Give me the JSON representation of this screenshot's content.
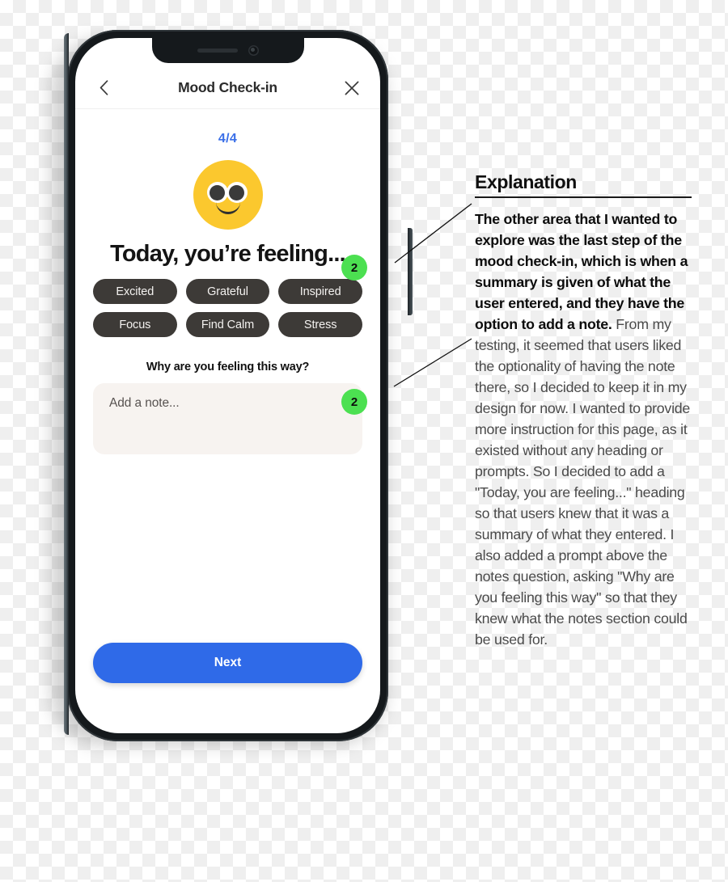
{
  "phone": {
    "header": {
      "back_icon": "chevron-left-icon",
      "title": "Mood Check-in",
      "close_icon": "close-icon"
    },
    "step_counter": "4/4",
    "emoji": "smiling-face-emoji",
    "headline": "Today, you’re feeling...",
    "chips": [
      "Excited",
      "Grateful",
      "Inspired",
      "Focus",
      "Find Calm",
      "Stress"
    ],
    "note_prompt": "Why are you feeling this way?",
    "note_placeholder": "Add a note...",
    "note_value": "",
    "next_label": "Next",
    "colors": {
      "accent_blue": "#2f6ae8",
      "step_blue": "#3a6fe8",
      "chip_dark": "#3d3a37",
      "note_bg": "#f7f3f0",
      "emoji_yellow": "#fbc82e"
    }
  },
  "annotations": {
    "badge_heading": "2",
    "badge_note": "2",
    "badge_color": "#4ce051"
  },
  "explanation": {
    "title": "Explanation",
    "bold_lead": "The other area that I wanted to explore was the last step of the mood check-in, which is when a summary is given of what the user entered, and they have the option to add a note.",
    "rest": " From my testing, it seemed that users liked the optionality of having the note there, so I decided to keep it in my design for now. I wanted to provide more instruction for this page, as it existed without any heading or prompts. So I decided to add a \"Today, you are feeling...\" heading so that users knew that it was a summary of what they entered. I also added a prompt above the notes question, asking \"Why are you feeling this way\" so that they knew what the notes section could be used for."
  }
}
